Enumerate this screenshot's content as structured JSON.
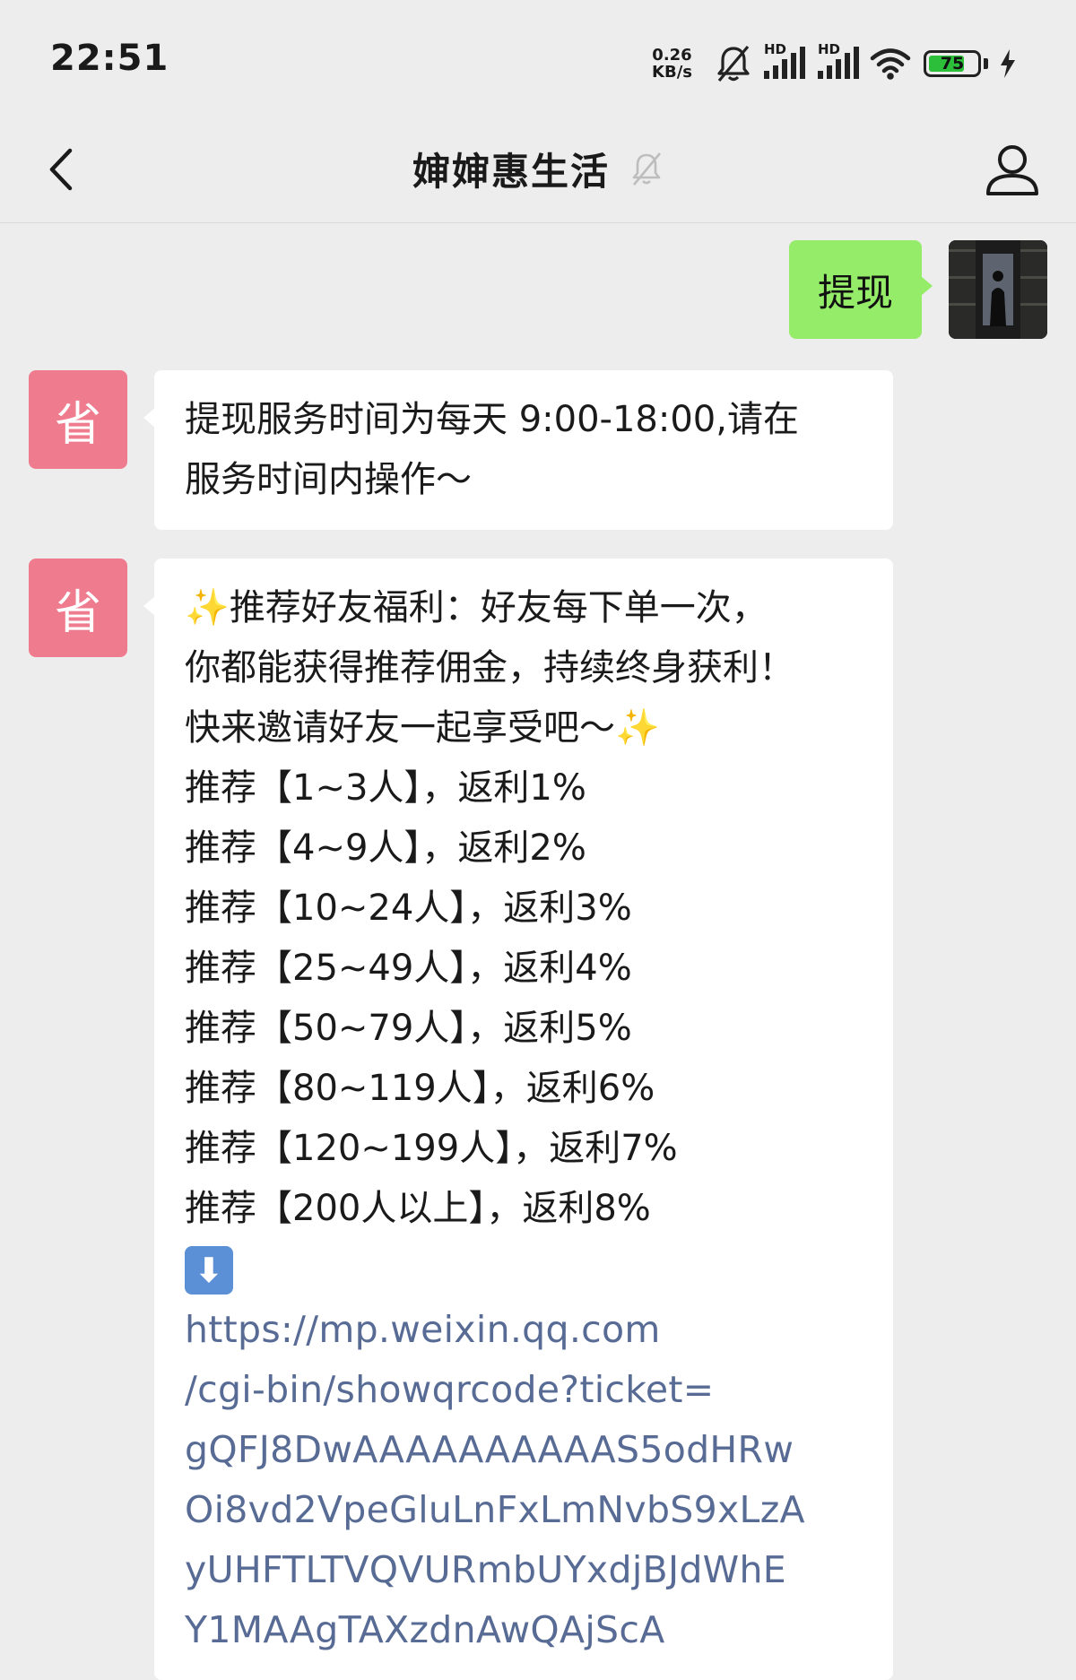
{
  "status_bar": {
    "time": "22:51",
    "net_speed_value": "0.26",
    "net_speed_unit": "KB/s",
    "signal_1_label": "HD",
    "signal_2_label": "HD",
    "battery_level": "75",
    "battery_fraction": 0.75,
    "icons": [
      "bell-muted-icon",
      "signal-icon",
      "signal-icon",
      "wifi-icon",
      "battery-icon",
      "charging-icon"
    ]
  },
  "nav": {
    "title": "婶婶惠生活",
    "icons": [
      "back-arrow-icon",
      "mute-icon",
      "profile-icon"
    ]
  },
  "messages": {
    "sent": {
      "text": "提现"
    },
    "bot_avatar_label": "省",
    "reply1": {
      "lines": [
        "提现服务时间为每天 9:00-18:00,请在",
        "服务时间内操作～"
      ]
    },
    "reply2": {
      "sparkle": "✨",
      "intro_line1": "推荐好友福利：好友每下单一次，",
      "intro_line2": "你都能获得推荐佣金，持续终身获利！",
      "intro_line3": "快来邀请好友一起享受吧～",
      "tiers": [
        "推荐【1~3人】，返利1%",
        "推荐【4~9人】，返利2%",
        "推荐【10~24人】，返利3%",
        "推荐【25~49人】，返利4%",
        "推荐【50~79人】，返利5%",
        "推荐【80~119人】，返利6%",
        "推荐【120~199人】，返利7%",
        "推荐【200人以上】，返利8%"
      ],
      "arrow_emoji": "⬇",
      "link_lines": [
        "https://mp.weixin.qq.com",
        "/cgi-bin/showqrcode?ticket=",
        "gQFJ8DwAAAAAAAAAAS5odHRw",
        "Oi8vd2VpeGluLnFxLmNvbS9xLzA",
        "yUHFTLTVQVURmbUYxdjBJdWhE",
        "Y1MAAgTAXzdnAwQAjScA"
      ]
    }
  },
  "colors": {
    "background": "#ededed",
    "sent_bubble": "#95ec69",
    "received_bubble": "#ffffff",
    "bot_avatar": "#ef7c8e",
    "link": "#576b95"
  }
}
